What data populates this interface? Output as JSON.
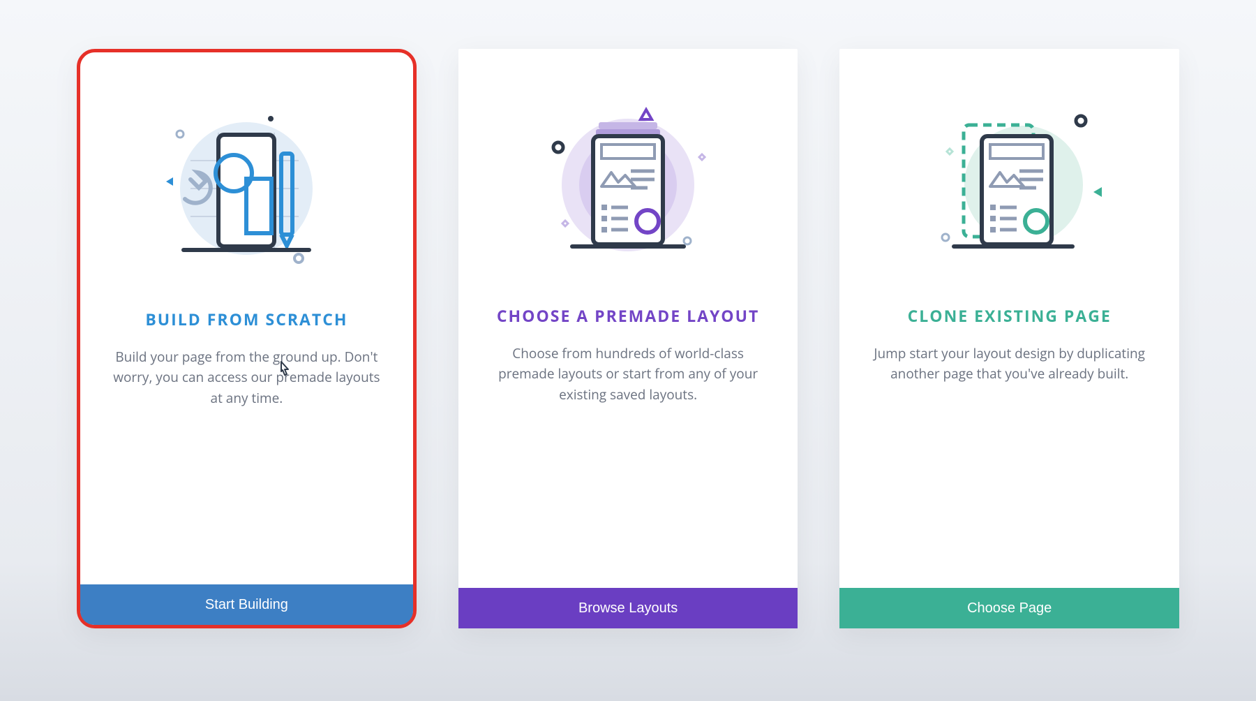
{
  "cards": [
    {
      "title": "BUILD FROM SCRATCH",
      "description": "Build your page from the ground up. Don't worry, you can access our premade layouts at any time.",
      "button": "Start Building",
      "accent": "#2d8fd6",
      "button_color": "#3d7fc4",
      "highlighted": true,
      "icon": "scratch-icon"
    },
    {
      "title": "CHOOSE A PREMADE LAYOUT",
      "description": "Choose from hundreds of world-class premade layouts or start from any of your existing saved layouts.",
      "button": "Browse Layouts",
      "accent": "#7345c6",
      "button_color": "#6a3ec2",
      "highlighted": false,
      "icon": "premade-icon"
    },
    {
      "title": "CLONE EXISTING PAGE",
      "description": "Jump start your layout design by duplicating another page that you've already built.",
      "button": "Choose Page",
      "accent": "#3bb095",
      "button_color": "#3bb095",
      "highlighted": false,
      "icon": "clone-icon"
    }
  ]
}
